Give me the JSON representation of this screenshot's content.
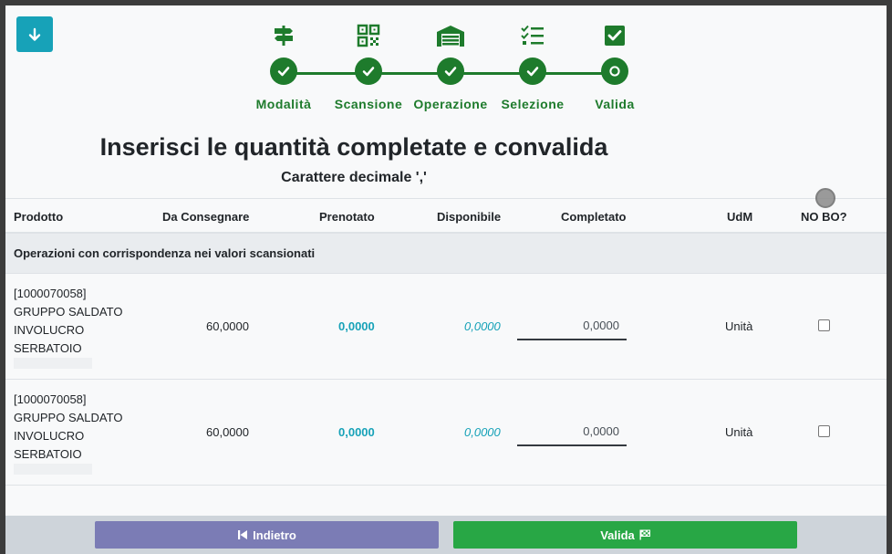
{
  "stepper": {
    "steps": [
      {
        "label": "Modalità",
        "icon": "signpost-icon",
        "state": "done"
      },
      {
        "label": "Scansione",
        "icon": "qr-code-icon",
        "state": "done"
      },
      {
        "label": "Operazione",
        "icon": "warehouse-icon",
        "state": "done"
      },
      {
        "label": "Selezione",
        "icon": "checklist-icon",
        "state": "done"
      },
      {
        "label": "Valida",
        "icon": "check-square-icon",
        "state": "current"
      }
    ]
  },
  "page": {
    "title": "Inserisci le quantità completate e convalida",
    "subtitle": "Carattere decimale ','"
  },
  "table": {
    "headers": {
      "product": "Prodotto",
      "to_deliver": "Da Consegnare",
      "reserved": "Prenotato",
      "available": "Disponibile",
      "completed": "Completato",
      "uom": "UdM",
      "no_bo": "NO BO?"
    },
    "group_label": "Operazioni con corrispondenza nei valori scansionati",
    "rows": [
      {
        "code": "[1000070058]",
        "name_line1": "GRUPPO SALDATO",
        "name_line2": "INVOLUCRO",
        "name_line3": "SERBATOIO",
        "to_deliver": "60,0000",
        "reserved": "0,0000",
        "available": "0,0000",
        "completed": "0,0000",
        "uom": "Unità",
        "no_bo": false
      },
      {
        "code": "[1000070058]",
        "name_line1": "GRUPPO SALDATO",
        "name_line2": "INVOLUCRO",
        "name_line3": "SERBATOIO",
        "to_deliver": "60,0000",
        "reserved": "0,0000",
        "available": "0,0000",
        "completed": "0,0000",
        "uom": "Unità",
        "no_bo": false
      }
    ]
  },
  "footer": {
    "back_label": "Indietro",
    "validate_label": "Valida"
  },
  "colors": {
    "accent_green": "#1e7b2c",
    "teal": "#17a2b8",
    "back_button": "#7b7cb5",
    "validate_button": "#28a745"
  }
}
